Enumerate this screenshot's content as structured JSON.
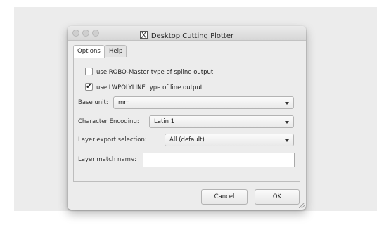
{
  "window": {
    "title": "Desktop Cutting Plotter"
  },
  "tabs": [
    {
      "label": "Options",
      "active": true
    },
    {
      "label": "Help",
      "active": false
    }
  ],
  "options": {
    "robo_master": {
      "label": "use ROBO-Master type of spline output",
      "checked": false
    },
    "lwpolyline": {
      "label": "use LWPOLYLINE type of line output",
      "checked": true
    },
    "base_unit": {
      "label": "Base unit:",
      "value": "mm"
    },
    "character_encoding": {
      "label": "Character Encoding:",
      "value": "Latin 1"
    },
    "layer_export_selection": {
      "label": "Layer export selection:",
      "value": "All (default)"
    },
    "layer_match_name": {
      "label": "Layer match name:",
      "value": ""
    }
  },
  "buttons": {
    "cancel": "Cancel",
    "ok": "OK"
  },
  "icons": {
    "check": "✔"
  }
}
